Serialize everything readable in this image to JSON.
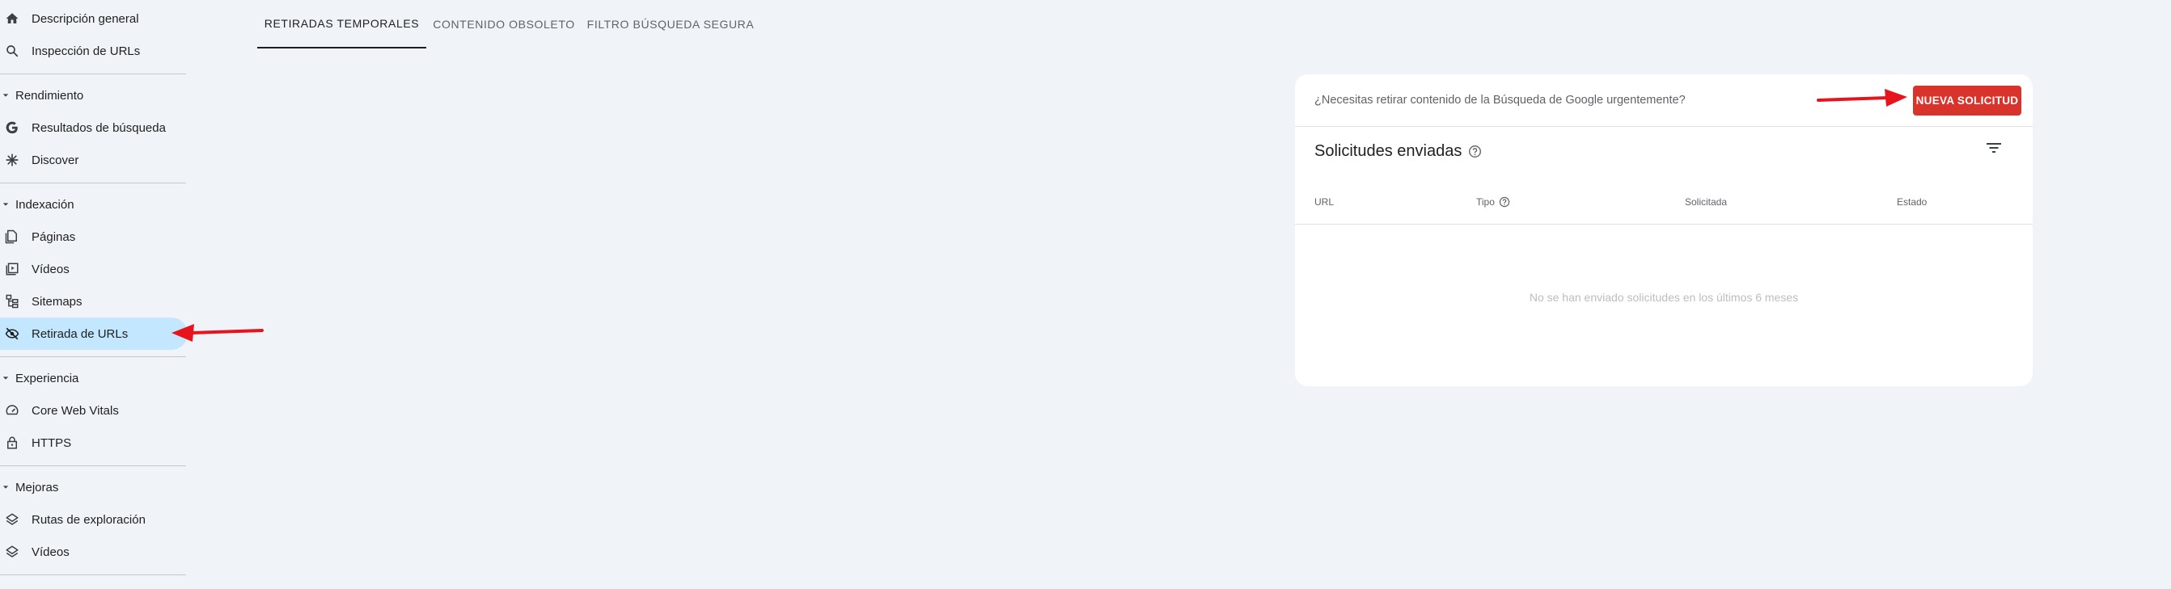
{
  "sidebar": {
    "items": [
      {
        "label": "Descripción general",
        "icon": "home-icon"
      },
      {
        "label": "Inspección de URLs",
        "icon": "search-icon"
      }
    ],
    "sections": [
      {
        "title": "Rendimiento",
        "items": [
          {
            "label": "Resultados de búsqueda",
            "icon": "google-g-icon"
          },
          {
            "label": "Discover",
            "icon": "asterisk-icon"
          }
        ]
      },
      {
        "title": "Indexación",
        "items": [
          {
            "label": "Páginas",
            "icon": "pages-icon"
          },
          {
            "label": "Vídeos",
            "icon": "video-pages-icon"
          },
          {
            "label": "Sitemaps",
            "icon": "sitemap-icon"
          },
          {
            "label": "Retirada de URLs",
            "icon": "eye-off-icon",
            "active": true
          }
        ]
      },
      {
        "title": "Experiencia",
        "items": [
          {
            "label": "Core Web Vitals",
            "icon": "speedometer-icon"
          },
          {
            "label": "HTTPS",
            "icon": "lock-icon"
          }
        ]
      },
      {
        "title": "Mejoras",
        "items": [
          {
            "label": "Rutas de exploración",
            "icon": "layers-icon"
          },
          {
            "label": "Vídeos",
            "icon": "layers-icon"
          }
        ]
      }
    ]
  },
  "tabs": [
    {
      "label": "RETIRADAS TEMPORALES",
      "active": true
    },
    {
      "label": "CONTENIDO OBSOLETO",
      "active": false
    },
    {
      "label": "FILTRO BÚSQUEDA SEGURA",
      "active": false
    }
  ],
  "card": {
    "question": "¿Necesitas retirar contenido de la Búsqueda de Google urgentemente?",
    "new_request_button": "NUEVA SOLICITUD",
    "title": "Solicitudes enviadas",
    "columns": [
      "URL",
      "Tipo",
      "Solicitada",
      "Estado"
    ],
    "empty_message": "No se han enviado solicitudes en los últimos 6 meses"
  },
  "colors": {
    "accent_button": "#d9342b",
    "active_nav": "#c2e7ff",
    "annotation_arrow": "#e8141b",
    "background": "#f0f4f9"
  }
}
